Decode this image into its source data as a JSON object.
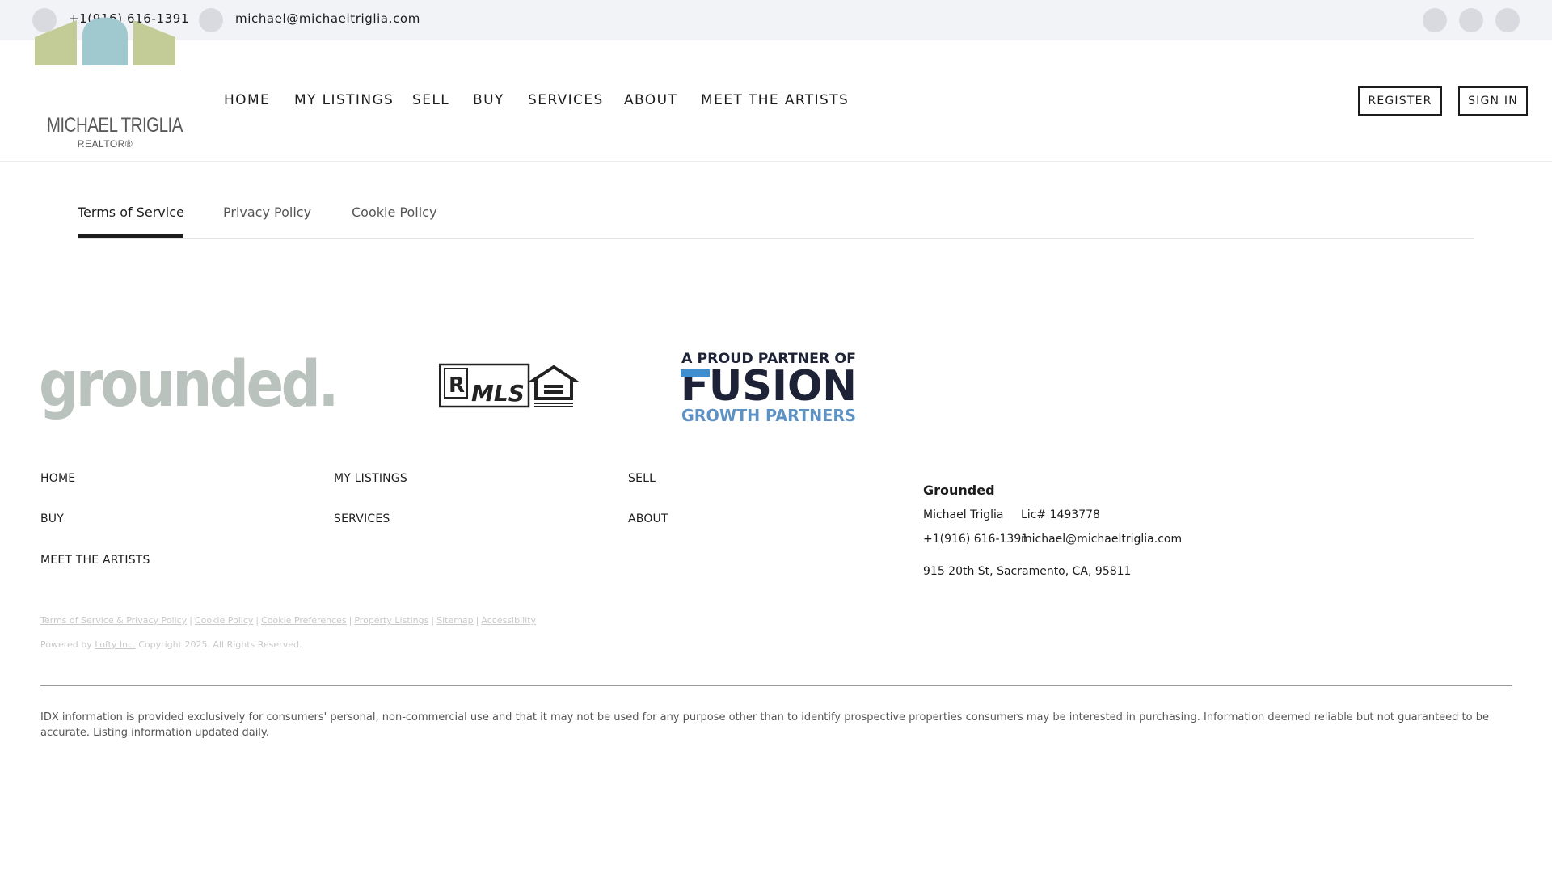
{
  "topbar": {
    "phone": "+1(916) 616-1391",
    "email": "michael@michaeltriglia.com",
    "social_icons": [
      "social-icon-1",
      "social-icon-2",
      "social-icon-3"
    ]
  },
  "brand": {
    "name": "MICHAEL TRIGLIA",
    "subtitle": "REALTOR®",
    "colors": {
      "green": "#c3cc96",
      "teal": "#9fc8cf"
    }
  },
  "nav": {
    "items": [
      "HOME",
      "MY LISTINGS",
      "SELL",
      "BUY",
      "SERVICES",
      "ABOUT",
      "MEET THE ARTISTS"
    ],
    "register_label": "REGISTER",
    "signin_label": "SIGN IN"
  },
  "tabs": {
    "items": [
      "Terms of Service",
      "Privacy Policy",
      "Cookie Policy"
    ],
    "active": "Terms of Service"
  },
  "partner_logos": {
    "grounded": "grounded.",
    "mls_text": "MLS",
    "realtor_mark": "R",
    "fusion_line1": "A PROUD PARTNER OF",
    "fusion_line2": "FUSION",
    "fusion_line3": "GROWTH PARTNERS",
    "colors": {
      "grounded": "#b9c2bd",
      "fusion_dark": "#1d2236",
      "fusion_blue": "#3f8fcf",
      "growth": "#5e92c4"
    }
  },
  "footer_nav": [
    "HOME",
    "MY LISTINGS",
    "SELL",
    "BUY",
    "SERVICES",
    "ABOUT",
    "MEET THE ARTISTS"
  ],
  "footer_contact": {
    "title": "Grounded",
    "agent": "Michael Triglia",
    "license": "Lic# 1493778",
    "phone": "+1(916) 616-1391",
    "email": "michael@michaeltriglia.com",
    "address": "915 20th St, Sacramento, CA, 95811"
  },
  "legal_links": [
    "Terms of Service & Privacy Policy",
    "Cookie Policy",
    "Cookie Preferences",
    "Property Listings",
    "Sitemap",
    "Accessibility"
  ],
  "powered": {
    "prefix": "Powered by",
    "company": "Lofty Inc.",
    "copyright": "Copyright 2025. All Rights Reserved."
  },
  "disclaimer": "IDX information is provided exclusively for consumers' personal, non-commercial use and that it may not be used for any purpose other than to identify prospective properties consumers may be interested in purchasing. Information deemed reliable but not guaranteed to be accurate. Listing information updated daily."
}
